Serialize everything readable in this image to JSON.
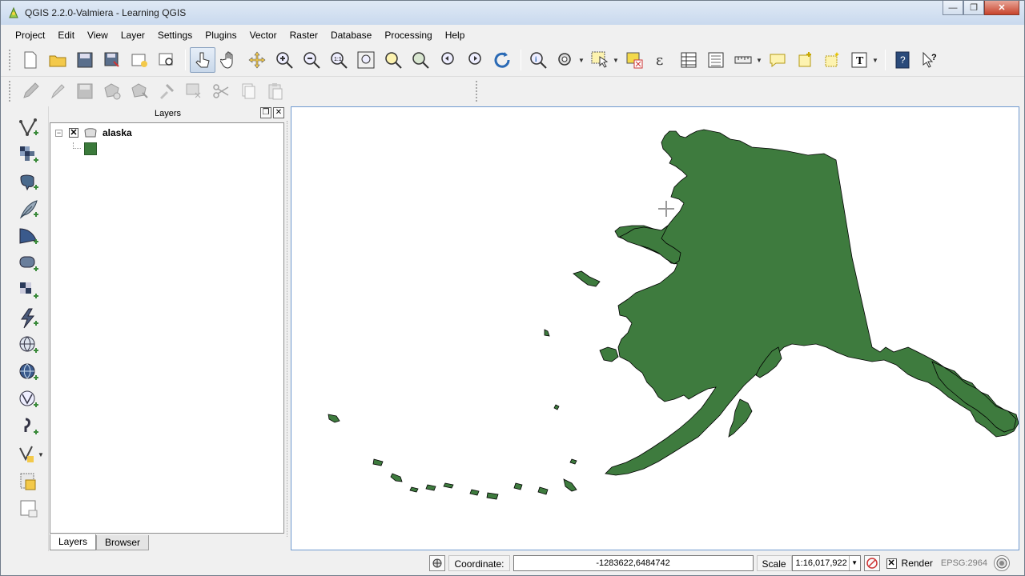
{
  "window": {
    "title": "QGIS 2.2.0-Valmiera - Learning QGIS"
  },
  "menubar": {
    "items": [
      "Project",
      "Edit",
      "View",
      "Layer",
      "Settings",
      "Plugins",
      "Vector",
      "Raster",
      "Database",
      "Processing",
      "Help"
    ]
  },
  "layers_panel": {
    "title": "Layers",
    "layer": {
      "name": "alaska",
      "checked": true,
      "symbol_color": "#3b7a3b"
    },
    "tabs": [
      "Layers",
      "Browser"
    ],
    "active_tab": "Layers"
  },
  "map": {
    "fill_color": "#3e7b3e",
    "outline_color": "#000000",
    "background": "#ffffff"
  },
  "statusbar": {
    "coordinate_label": "Coordinate:",
    "coordinate_value": "-1283622,6484742",
    "scale_label": "Scale",
    "scale_value": "1:16,017,922",
    "render_label": "Render",
    "render_checked": true,
    "crs": "EPSG:2964"
  },
  "colors": {
    "accent": "#6f9ad0",
    "chrome": "#f0f0f0",
    "feature": "#3e7b3e"
  }
}
